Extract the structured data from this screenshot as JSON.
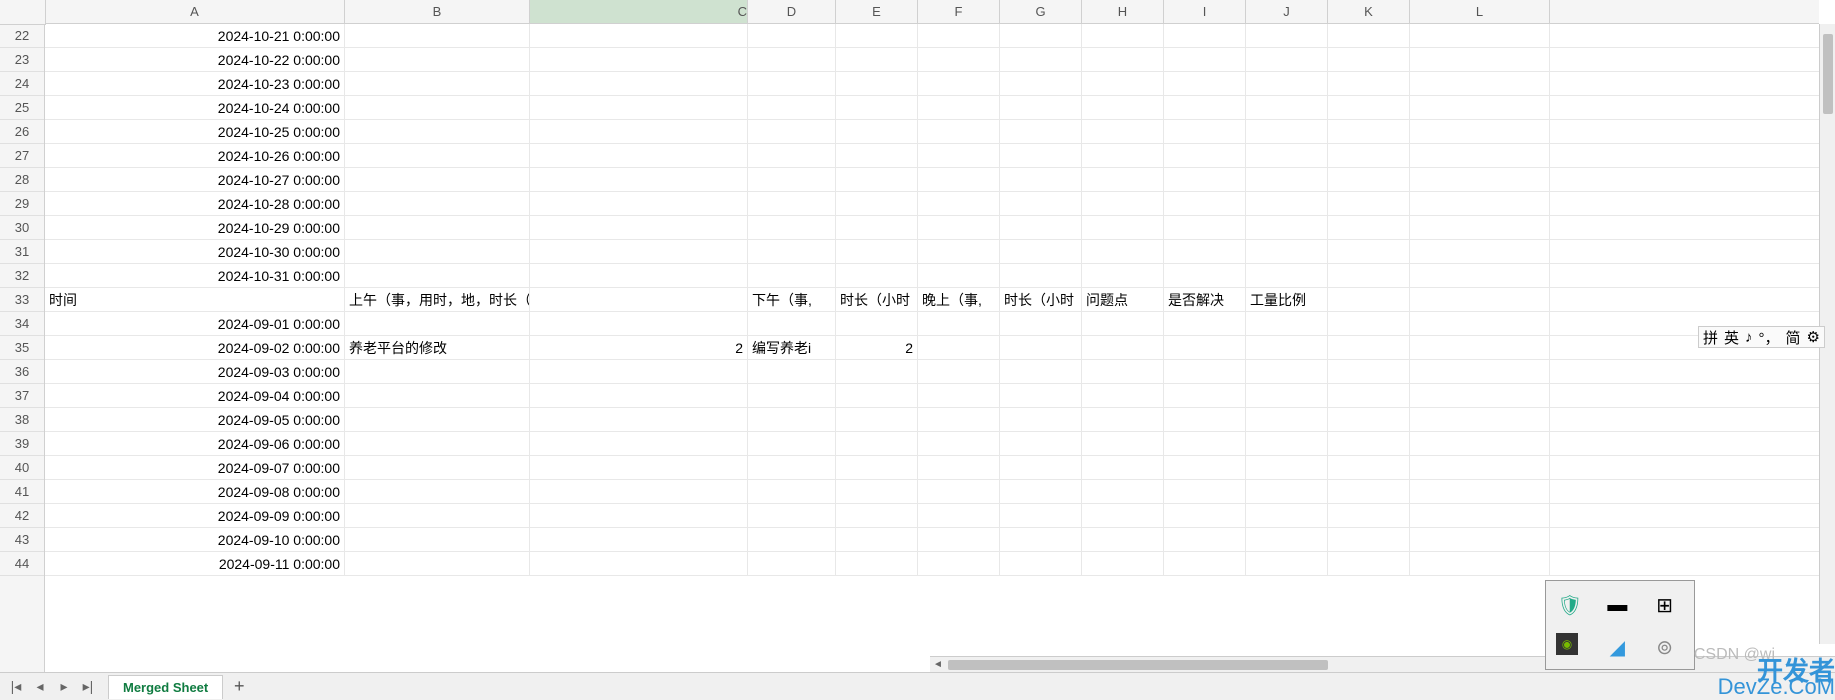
{
  "columns": [
    "A",
    "B",
    "C",
    "D",
    "E",
    "F",
    "G",
    "H",
    "I",
    "J",
    "K",
    "L"
  ],
  "activeColumn": "C",
  "firstRow": 22,
  "rows": [
    {
      "n": 22,
      "A": "2024-10-21 0:00:00"
    },
    {
      "n": 23,
      "A": "2024-10-22 0:00:00"
    },
    {
      "n": 24,
      "A": "2024-10-23 0:00:00"
    },
    {
      "n": 25,
      "A": "2024-10-24 0:00:00"
    },
    {
      "n": 26,
      "A": "2024-10-25 0:00:00"
    },
    {
      "n": 27,
      "A": "2024-10-26 0:00:00"
    },
    {
      "n": 28,
      "A": "2024-10-27 0:00:00"
    },
    {
      "n": 29,
      "A": "2024-10-28 0:00:00"
    },
    {
      "n": 30,
      "A": "2024-10-29 0:00:00"
    },
    {
      "n": 31,
      "A": "2024-10-30 0:00:00"
    },
    {
      "n": 32,
      "A": "2024-10-31 0:00:00"
    },
    {
      "n": 33,
      "A": "时间",
      "B": "上午（事，用时，地，时长（小时）",
      "D": "下午（事,",
      "E": "时长（小时",
      "F": "晚上（事,",
      "G": "时长（小时",
      "H": "问题点",
      "I": "是否解决",
      "J": "工量比例",
      "left": true
    },
    {
      "n": 34,
      "A": "2024-09-01 0:00:00"
    },
    {
      "n": 35,
      "A": "2024-09-02 0:00:00",
      "B": "养老平台的修改",
      "C": "2",
      "D": "编写养老i",
      "E": "2",
      "eRight": true
    },
    {
      "n": 36,
      "A": "2024-09-03 0:00:00"
    },
    {
      "n": 37,
      "A": "2024-09-04 0:00:00"
    },
    {
      "n": 38,
      "A": "2024-09-05 0:00:00"
    },
    {
      "n": 39,
      "A": "2024-09-06 0:00:00"
    },
    {
      "n": 40,
      "A": "2024-09-07 0:00:00"
    },
    {
      "n": 41,
      "A": "2024-09-08 0:00:00"
    },
    {
      "n": 42,
      "A": "2024-09-09 0:00:00"
    },
    {
      "n": 43,
      "A": "2024-09-10 0:00:00"
    },
    {
      "n": 44,
      "A": "2024-09-11 0:00:00"
    }
  ],
  "sheetTab": "Merged Sheet",
  "ime": {
    "items": [
      "拼",
      "英",
      "♪",
      "°，",
      "简",
      "⚙"
    ]
  },
  "watermark": {
    "top": "开发者",
    "bottom": "DevZe.CoM",
    "csdn": "CSDN @wi"
  }
}
